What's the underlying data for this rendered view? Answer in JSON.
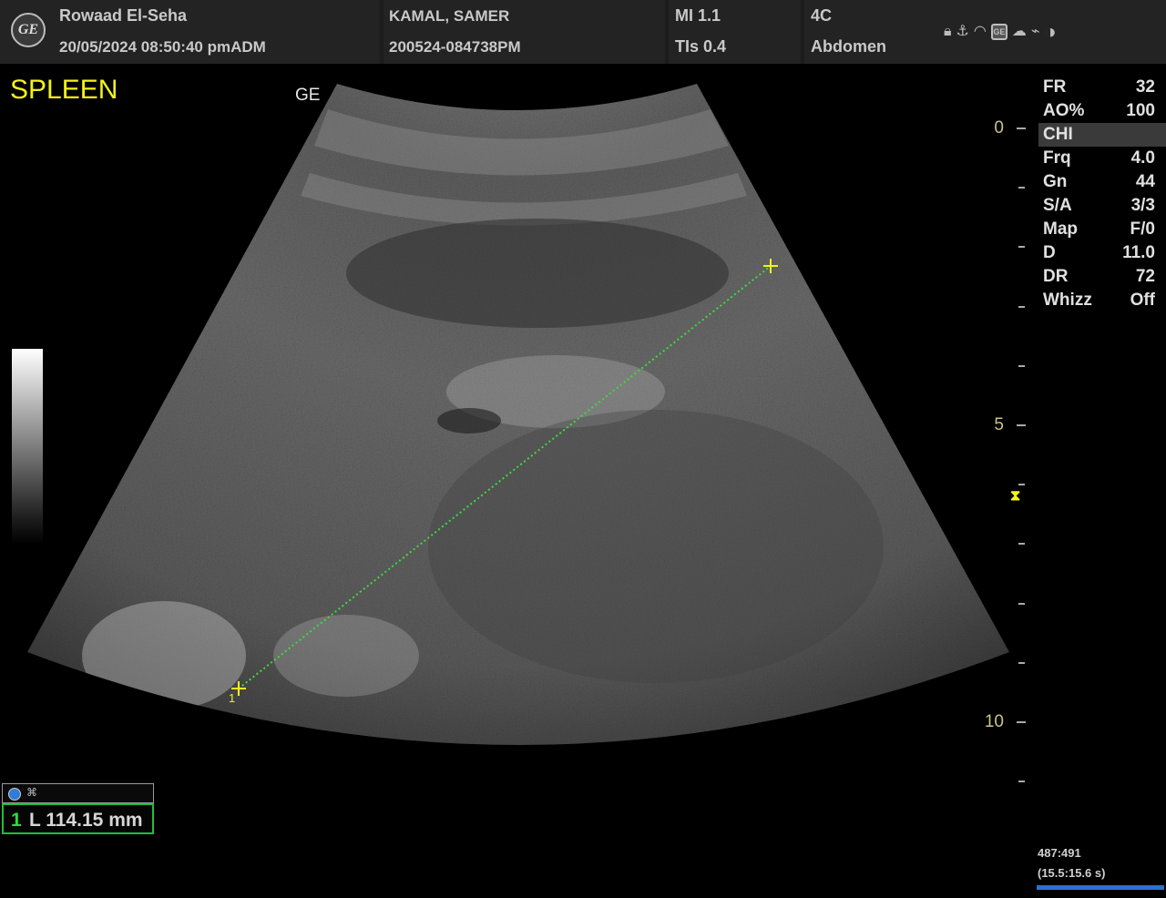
{
  "header": {
    "facility": "Rowaad El-Seha",
    "datetime": "20/05/2024 08:50:40 pmADM",
    "patient_name": "KAMAL, SAMER",
    "patient_id": "200524-084738PM",
    "mi": "MI 1.1",
    "tis": "TIs 0.4",
    "probe": "4C",
    "exam": "Abdomen",
    "logo_text": "GE",
    "status_icons": [
      "lock-icon",
      "usb-icon",
      "wifi-icon",
      "ge-box-icon",
      "cloud-icon",
      "plug-icon",
      "contrast-icon"
    ]
  },
  "image": {
    "preset_label": "SPLEEN",
    "orientation_mark": "GE"
  },
  "depth_scale": {
    "labels": [
      "0",
      "5",
      "10"
    ],
    "ticks_cm": [
      0,
      1,
      2,
      3,
      4,
      5,
      6,
      7,
      8,
      9,
      10,
      11
    ],
    "focus_cm": 6.2
  },
  "params": [
    {
      "key": "FR",
      "value": "32"
    },
    {
      "key": "AO%",
      "value": "100"
    },
    {
      "key": "CHI",
      "value": ""
    },
    {
      "key": "Frq",
      "value": "4.0"
    },
    {
      "key": "Gn",
      "value": "44"
    },
    {
      "key": "S/A",
      "value": "3/3"
    },
    {
      "key": "Map",
      "value": "F/0"
    },
    {
      "key": "D",
      "value": "11.0"
    },
    {
      "key": "DR",
      "value": "72"
    },
    {
      "key": "Whizz",
      "value": "Off"
    }
  ],
  "measurement": {
    "index": "1",
    "label": "L 114.15 mm",
    "caliper_marker": "1"
  },
  "cine": {
    "frames": "487:491",
    "time": "(15.5:15.6 s)"
  },
  "colors": {
    "preset": "#f2f21c",
    "caliper": "#f2f21c",
    "measure_line": "#3ddc3d",
    "measure_box": "#1fbf3a",
    "cine_bar": "#2e6fd4"
  }
}
